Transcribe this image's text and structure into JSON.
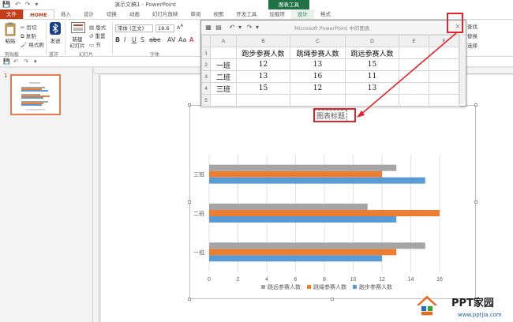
{
  "window": {
    "title": "演示文稿1 - PowerPoint",
    "contextual_group": "图表工具"
  },
  "quick_access": [
    "💾",
    "↶",
    "↷",
    "▾"
  ],
  "tabs": [
    "文件",
    "HOME",
    "插入",
    "设计",
    "切换",
    "动画",
    "幻灯片放映",
    "审阅",
    "视图",
    "开发工具",
    "加载项",
    "设计",
    "格式"
  ],
  "ribbon": {
    "paste": "粘贴",
    "cut": "剪切",
    "copy": "复制",
    "format_painter": "格式刷",
    "send_label": "发送",
    "new_slide": "新建\n幻灯片",
    "layout": "版式",
    "reset": "重置",
    "section": "节",
    "font_name": "宋体 (正文)",
    "font_size": "18.6",
    "grp_clipboard": "剪贴板",
    "grp_bluetooth": "蓝牙",
    "grp_slides": "幻灯片",
    "grp_font": "字体",
    "side_find": "查找",
    "side_replace": "替换",
    "side_select": "选择"
  },
  "slides": {
    "current_number": "1"
  },
  "sheet": {
    "title": "Microsoft PowerPoint 中的图表",
    "close": "×",
    "col_letters": [
      "",
      "A",
      "B",
      "C",
      "D",
      "E",
      "F"
    ],
    "rows": [
      {
        "n": "1",
        "cells": [
          "",
          "跑步参赛人数",
          "跳绳参赛人数",
          "跳远参赛人数",
          "",
          ""
        ]
      },
      {
        "n": "2",
        "cells": [
          "一班",
          "12",
          "13",
          "15",
          "",
          ""
        ]
      },
      {
        "n": "3",
        "cells": [
          "二班",
          "13",
          "16",
          "11",
          "",
          ""
        ]
      },
      {
        "n": "4",
        "cells": [
          "三班",
          "15",
          "12",
          "13",
          "",
          ""
        ]
      },
      {
        "n": "5",
        "cells": [
          "",
          "",
          "",
          "",
          "",
          ""
        ]
      }
    ]
  },
  "chart_data": {
    "type": "bar",
    "orientation": "horizontal",
    "title": "图表标题",
    "categories": [
      "一班",
      "二班",
      "三班"
    ],
    "series": [
      {
        "name": "跑步参赛人数",
        "values": [
          12,
          13,
          15
        ],
        "color": "#5b9bd5"
      },
      {
        "name": "跳绳参赛人数",
        "values": [
          13,
          16,
          12
        ],
        "color": "#ed7d31"
      },
      {
        "name": "跳远参赛人数",
        "values": [
          15,
          11,
          13
        ],
        "color": "#a5a5a5"
      }
    ],
    "xlim": [
      0,
      16
    ],
    "xticks": [
      "0",
      "2",
      "4",
      "6",
      "8",
      "10",
      "12",
      "14",
      "16"
    ],
    "grid": true,
    "legend_position": "bottom"
  },
  "watermark": {
    "brand": "PPT家园",
    "url": "www.pptjia.com"
  },
  "colors": {
    "accent": "#c43e1c",
    "ctx_green": "#217346",
    "annotation_red": "#e0242a"
  }
}
